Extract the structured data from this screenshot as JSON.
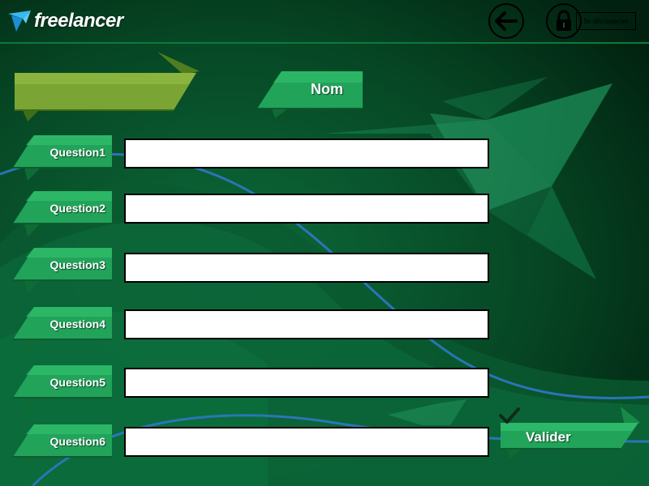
{
  "header": {
    "brand": "freelancer",
    "back_icon": "arrow-left-icon",
    "lock_icon": "lock-icon",
    "logout_label": "Se déconnecter"
  },
  "form": {
    "title_label": "Nom",
    "questions": [
      {
        "label": "Question1",
        "value": ""
      },
      {
        "label": "Question2",
        "value": ""
      },
      {
        "label": "Question3",
        "value": ""
      },
      {
        "label": "Question4",
        "value": ""
      },
      {
        "label": "Question5",
        "value": ""
      },
      {
        "label": "Question6",
        "value": ""
      }
    ],
    "submit_label": "Valider"
  },
  "colors": {
    "background": "#032a16",
    "ribbon_green": "#22a35a",
    "ribbon_olive": "#7aa534",
    "accent_line": "#0b7a3c"
  }
}
